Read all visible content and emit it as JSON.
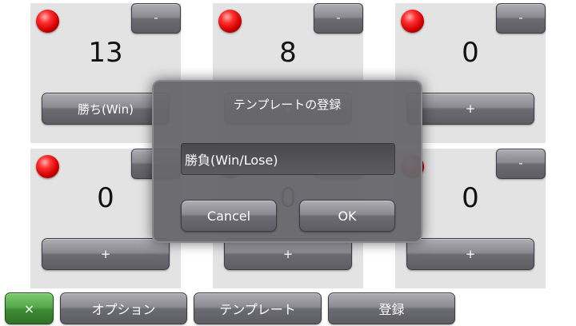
{
  "counters": [
    {
      "count": "13",
      "minus_label": "-",
      "button_label": "勝ち(Win)"
    },
    {
      "count": "8",
      "minus_label": "-",
      "button_label": "+"
    },
    {
      "count": "0",
      "minus_label": "-",
      "button_label": "+"
    },
    {
      "count": "0",
      "minus_label": "-",
      "button_label": "+"
    },
    {
      "count": "0",
      "minus_label": "-",
      "button_label": "+"
    },
    {
      "count": "0",
      "minus_label": "-",
      "button_label": "+"
    }
  ],
  "bottom_bar": {
    "close_label": "×",
    "options_label": "オプション",
    "template_label": "テンプレート",
    "register_label": "登録"
  },
  "dialog": {
    "title": "テンプレートの登録",
    "input_value": "勝負(Win/Lose)",
    "cancel_label": "Cancel",
    "ok_label": "OK"
  },
  "icons": {
    "indicator": "red-led-icon"
  },
  "colors": {
    "led": "#e00000",
    "accent_green": "#4e9e43",
    "button_gray": "#7a7a80"
  }
}
